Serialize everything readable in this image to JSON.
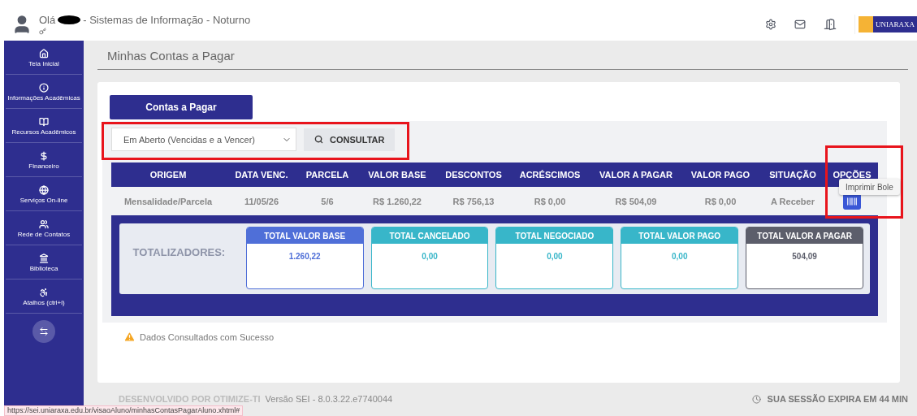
{
  "header": {
    "greeting": "Olá",
    "course": "- Sistemas de Informação - Noturno",
    "logo_text": "UNIARAXA"
  },
  "sidebar": {
    "items": [
      {
        "label": "Tela Inicial"
      },
      {
        "label": "Informações Acadêmicas"
      },
      {
        "label": "Recursos Acadêmicos"
      },
      {
        "label": "Financeiro"
      },
      {
        "label": "Serviços On-line"
      },
      {
        "label": "Rede de Contatos"
      },
      {
        "label": "Biblioteca"
      },
      {
        "label": "Atalhos (ctrl+i)"
      }
    ]
  },
  "page_title": "Minhas Contas a Pagar",
  "tab": {
    "label": "Contas a Pagar"
  },
  "filter": {
    "value": "Em Aberto (Vencidas e a Vencer)",
    "button": "CONSULTAR"
  },
  "table": {
    "columns": [
      "ORIGEM",
      "DATA VENC.",
      "PARCELA",
      "VALOR BASE",
      "DESCONTOS",
      "ACRÉSCIMOS",
      "VALOR A PAGAR",
      "VALOR PAGO",
      "SITUAÇÃO",
      "OPÇÕES"
    ],
    "rows": [
      {
        "cells": [
          "Mensalidade/Parcela",
          "11/05/26",
          "5/6",
          "R$ 1.260,22",
          "R$ 756,13",
          "R$ 0,00",
          "R$ 504,09",
          "R$ 0,00",
          "A Receber"
        ]
      }
    ]
  },
  "tooltip": "Imprimir Bole",
  "totals": {
    "label": "TOTALIZADORES:",
    "cards": [
      {
        "title": "TOTAL VALOR BASE",
        "value": "1.260,22",
        "color": "#4f6fd8"
      },
      {
        "title": "TOTAL CANCELADO",
        "value": "0,00",
        "color": "#38b6c9"
      },
      {
        "title": "TOTAL NEGOCIADO",
        "value": "0,00",
        "color": "#38b6c9"
      },
      {
        "title": "TOTAL VALOR PAGO",
        "value": "0,00",
        "color": "#38b6c9"
      },
      {
        "title": "TOTAL VALOR A PAGAR",
        "value": "504,09",
        "color": "#5c5e6b"
      }
    ]
  },
  "message": "Dados Consultados com Sucesso",
  "footer": {
    "developer": "DESENVOLVIDO POR OTIMIZE-TI",
    "version": "Versão SEI - 8.0.3.22.e7740044",
    "session": "SUA SESSÃO EXPIRA EM 44 MIN"
  },
  "status_url": "https://sei.uniaraxa.edu.br/visaoAluno/minhasContasPagarAluno.xhtml#"
}
